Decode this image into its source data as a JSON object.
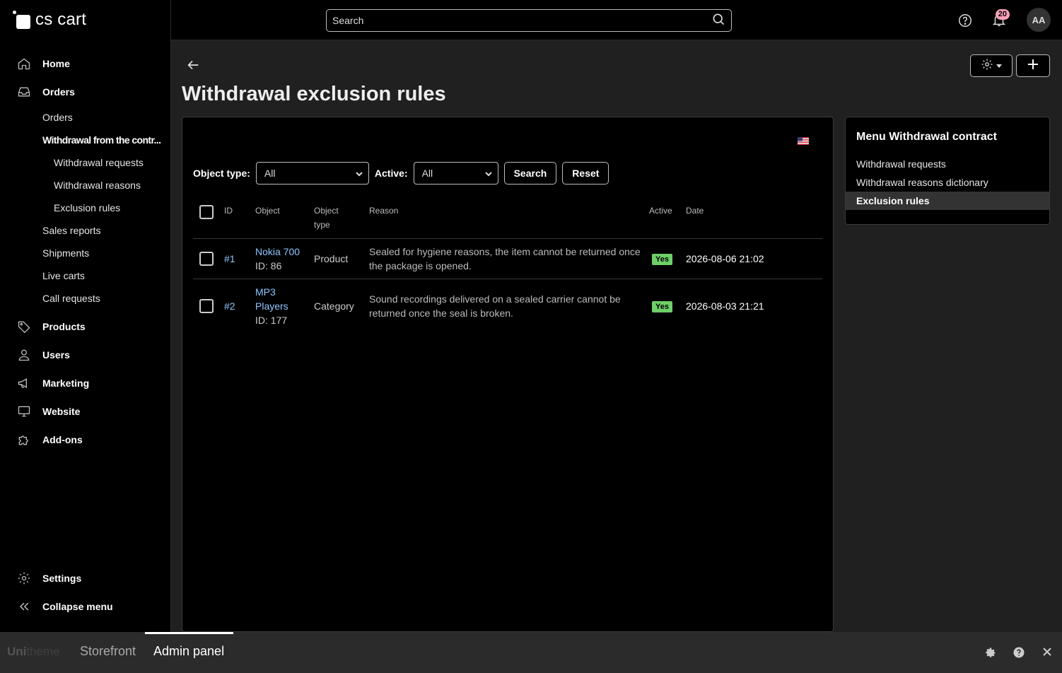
{
  "app": {
    "logo_text": "cs cart"
  },
  "sidebar": {
    "items": [
      {
        "label": "Home",
        "icon": "home-icon"
      },
      {
        "label": "Orders",
        "icon": "inbox-icon"
      }
    ],
    "orders_sub": [
      "Orders",
      "Withdrawal from the contr...",
      "Withdrawal requests",
      "Withdrawal reasons",
      "Exclusion rules",
      "Sales reports",
      "Shipments",
      "Live carts",
      "Call requests"
    ],
    "items_after": [
      {
        "label": "Products",
        "icon": "tag-icon"
      },
      {
        "label": "Users",
        "icon": "user-icon"
      },
      {
        "label": "Marketing",
        "icon": "megaphone-icon"
      },
      {
        "label": "Website",
        "icon": "monitor-icon"
      },
      {
        "label": "Add-ons",
        "icon": "puzzle-icon"
      }
    ],
    "bottom": [
      {
        "label": "Settings",
        "icon": "gear-icon"
      },
      {
        "label": "Collapse menu",
        "icon": "double-chevron-left-icon"
      }
    ]
  },
  "topbar": {
    "search_placeholder": "Search",
    "notification_count": "20",
    "avatar_initials": "AA"
  },
  "page": {
    "title": "Withdrawal exclusion rules"
  },
  "filters": {
    "object_type_label": "Object type:",
    "object_type_value": "All",
    "active_label": "Active:",
    "active_value": "All",
    "search_button": "Search",
    "reset_button": "Reset"
  },
  "table": {
    "headers": {
      "id": "ID",
      "object": "Object",
      "object_type_line1": "Object",
      "object_type_line2": "type",
      "reason": "Reason",
      "active": "Active",
      "date": "Date"
    },
    "rows": [
      {
        "id": "#1",
        "object_name": "Nokia 700",
        "object_id": "ID: 86",
        "object_type": "Product",
        "reason_line1": "Sealed for hygiene reasons, the item cannot be returned once",
        "reason_line2": "the package is opened.",
        "active": "Yes",
        "date": "2026-08-06 21:02"
      },
      {
        "id": "#2",
        "object_name_line1": "MP3",
        "object_name_line2": "Players",
        "object_id": "ID: 177",
        "object_type": "Category",
        "reason_line1": "Sound recordings delivered on a sealed carrier cannot be",
        "reason_line2": "returned once the seal is broken.",
        "active": "Yes",
        "date": "2026-08-03 21:21"
      }
    ]
  },
  "right_menu": {
    "title": "Menu Withdrawal contract",
    "items": [
      "Withdrawal requests",
      "Withdrawal reasons dictionary",
      "Exclusion rules"
    ]
  },
  "bottombar": {
    "brand_a": "Uni",
    "brand_b": "theme",
    "tabs": [
      "Storefront",
      "Admin panel"
    ]
  },
  "colors": {
    "link": "#8ec5ff",
    "badge": "#f7a1b8",
    "yes_badge": "#6fcf68"
  }
}
